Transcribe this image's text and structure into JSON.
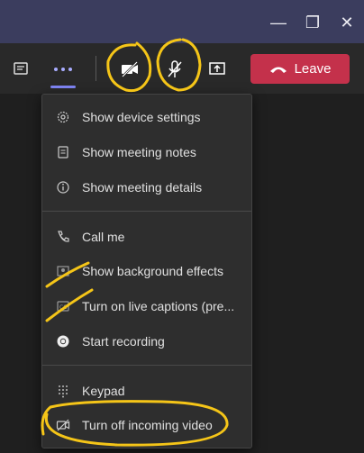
{
  "window": {
    "minimize": "—",
    "maximize": "❐",
    "close": "✕"
  },
  "toolbar": {
    "leave_label": "Leave"
  },
  "menu": {
    "items": [
      {
        "label": "Show device settings",
        "icon": "gear-icon"
      },
      {
        "label": "Show meeting notes",
        "icon": "notes-icon"
      },
      {
        "label": "Show meeting details",
        "icon": "info-icon"
      },
      {
        "label": "Call me",
        "icon": "phone-icon"
      },
      {
        "label": "Show background effects",
        "icon": "background-effects-icon"
      },
      {
        "label": "Turn on live captions (pre...",
        "icon": "captions-icon"
      },
      {
        "label": "Start recording",
        "icon": "record-icon"
      },
      {
        "label": "Keypad",
        "icon": "keypad-icon"
      },
      {
        "label": "Turn off incoming video",
        "icon": "video-off-icon"
      }
    ]
  },
  "colors": {
    "titlebar": "#3b3d5e",
    "leave": "#c4314b",
    "accent": "#7f85f5",
    "annotation": "#f5c518"
  }
}
